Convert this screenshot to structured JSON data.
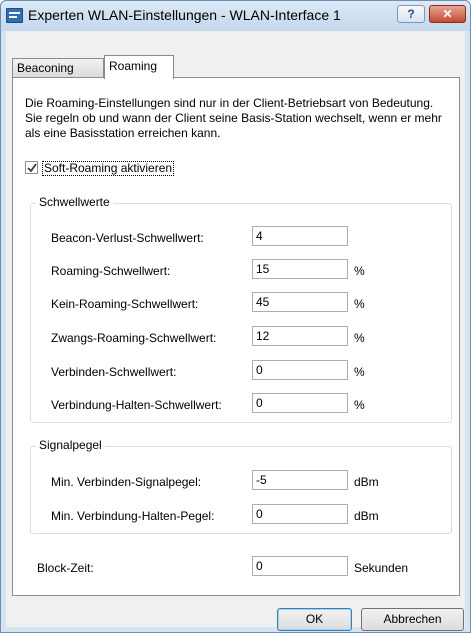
{
  "window": {
    "title": "Experten WLAN-Einstellungen - WLAN-Interface 1",
    "help_label": "?",
    "close_label": "x"
  },
  "tabs": [
    {
      "label": "Beaconing",
      "selected": false
    },
    {
      "label": "Roaming",
      "selected": true
    }
  ],
  "description": "Die Roaming-Einstellungen sind nur in der Client-Betriebsart von Bedeutung. Sie regeln ob und wann der Client seine Basis-Station wechselt, wenn er mehr als eine Basisstation erreichen kann.",
  "soft_roaming": {
    "label": "Soft-Roaming aktivieren",
    "checked": true
  },
  "schwellwerte": {
    "title": "Schwellwerte",
    "fields": [
      {
        "label": "Beacon-Verlust-Schwellwert:",
        "value": "4",
        "unit": ""
      },
      {
        "label": "Roaming-Schwellwert:",
        "value": "15",
        "unit": "%"
      },
      {
        "label": "Kein-Roaming-Schwellwert:",
        "value": "45",
        "unit": "%"
      },
      {
        "label": "Zwangs-Roaming-Schwellwert:",
        "value": "12",
        "unit": "%"
      },
      {
        "label": "Verbinden-Schwellwert:",
        "value": "0",
        "unit": "%"
      },
      {
        "label": "Verbindung-Halten-Schwellwert:",
        "value": "0",
        "unit": "%"
      }
    ]
  },
  "signalpegel": {
    "title": "Signalpegel",
    "fields": [
      {
        "label": "Min. Verbinden-Signalpegel:",
        "value": "-5",
        "unit": "dBm"
      },
      {
        "label": "Min. Verbindung-Halten-Pegel:",
        "value": "0",
        "unit": "dBm"
      }
    ]
  },
  "block_zeit": {
    "label": "Block-Zeit:",
    "value": "0",
    "unit": "Sekunden"
  },
  "buttons": {
    "ok": "OK",
    "cancel": "Abbrechen"
  }
}
